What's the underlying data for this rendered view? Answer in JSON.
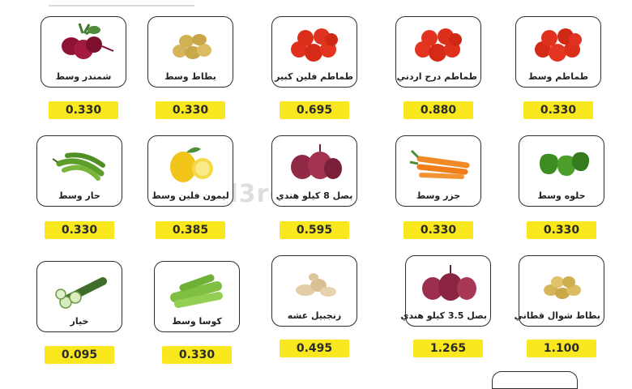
{
  "watermark": "el3rd.com",
  "products": [
    {
      "name": "شمندر وسط",
      "price": "0.330",
      "icon": "beetroot-icon"
    },
    {
      "name": "بطاط وسط",
      "price": "0.330",
      "icon": "potato-icon"
    },
    {
      "name": "طماطم فلين كبير",
      "price": "0.695",
      "icon": "tomato-icon"
    },
    {
      "name": "طماطم درج اردني",
      "price": "0.880",
      "icon": "tomato-icon"
    },
    {
      "name": "طماطم وسط",
      "price": "0.330",
      "icon": "tomato-icon"
    },
    {
      "name": "حار وسط",
      "price": "0.330",
      "icon": "green-chili-icon"
    },
    {
      "name": "ليمون فلين وسط",
      "price": "0.385",
      "icon": "lemon-icon"
    },
    {
      "name": "بصل 8 كيلو هندي",
      "price": "0.595",
      "icon": "red-onion-icon"
    },
    {
      "name": "جزر وسط",
      "price": "0.330",
      "icon": "carrot-icon"
    },
    {
      "name": "حلوه وسط",
      "price": "0.330",
      "icon": "bell-pepper-icon"
    },
    {
      "name": "خيار",
      "price": "0.095",
      "icon": "cucumber-icon"
    },
    {
      "name": "كوسا وسط",
      "price": "0.330",
      "icon": "zucchini-icon"
    },
    {
      "name": "زنجبيل عشه",
      "price": "0.495",
      "icon": "ginger-icon"
    },
    {
      "name": "بصل 3.5 كيلو هندي",
      "price": "1.265",
      "icon": "red-onion-icon"
    },
    {
      "name": "بطاط شوال قطاني",
      "price": "1.100",
      "icon": "potato-icon"
    }
  ]
}
